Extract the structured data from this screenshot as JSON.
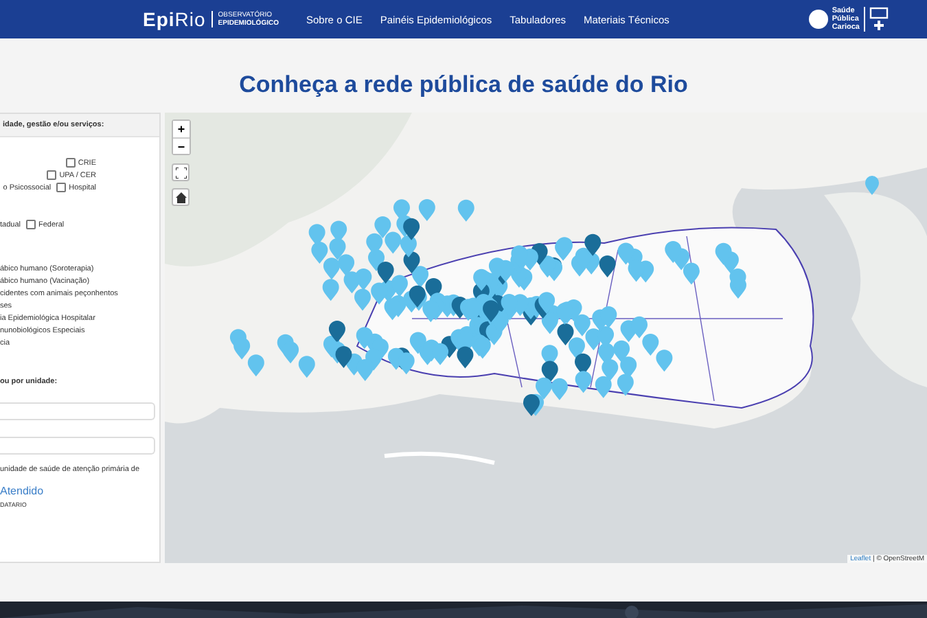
{
  "header": {
    "logo": {
      "main": "Epi",
      "accent": "Rio",
      "subtitle": "OBSERVATÓRIO",
      "subtitle_bold": "EPIDEMIOLÓGICO"
    },
    "nav": [
      "Sobre o CIE",
      "Painéis Epidemiológicos",
      "Tabuladores",
      "Materiais Técnicos"
    ],
    "partner_logo": {
      "lines": [
        "Saúde",
        "Pública",
        "Carioca"
      ]
    }
  },
  "title": "Conheça a rede pública de saúde do Rio",
  "filters": {
    "heading": "idade, gestão e/ou serviços:",
    "unit_types": [
      {
        "label": "CRIE",
        "checked": false
      },
      {
        "label": "UPA / CER",
        "checked": false
      },
      {
        "label": "Hospital",
        "checked": false,
        "prefix": "o Psicossocial"
      }
    ],
    "management": [
      {
        "label": "Federal",
        "checked": false,
        "prefix": "tadual"
      }
    ],
    "services": [
      "ábico humano (Soroterapia)",
      "ábico humano (Vacinação)",
      "cidentes com animais peçonhentos",
      "ses",
      "ia Epidemiológica Hospitalar",
      "nunobiológicos Especiais",
      "cia"
    ],
    "search_heading": "ou por unidade:",
    "fields": [
      {
        "kind": "text"
      },
      {
        "kind": "text"
      }
    ],
    "note": "unidade de saúde de atenção primária de",
    "link": "Atendido",
    "source": "DATARIO"
  },
  "map": {
    "controls": [
      "+",
      "−"
    ],
    "attribution": {
      "link": "Leaflet",
      "rest": "| © OpenStreetM"
    }
  }
}
